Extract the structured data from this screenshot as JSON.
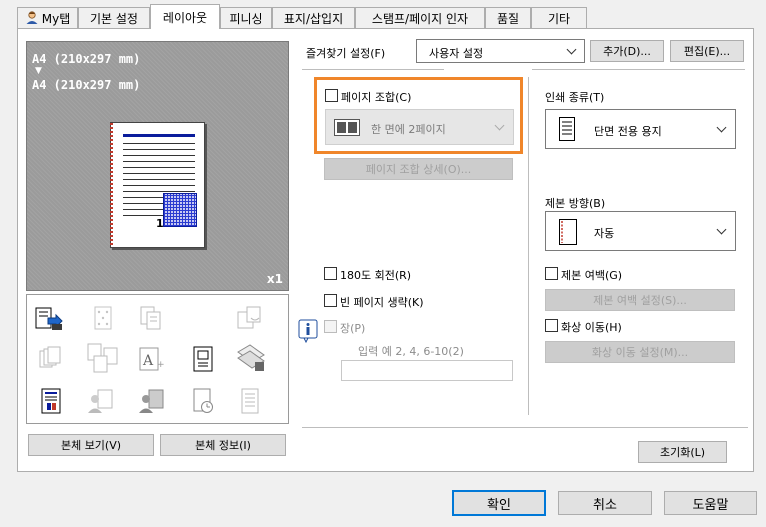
{
  "tabs": [
    {
      "label": "My탭",
      "active": false
    },
    {
      "label": "기본 설정",
      "active": false
    },
    {
      "label": "레이아웃",
      "active": true
    },
    {
      "label": "피니싱",
      "active": false
    },
    {
      "label": "표지/삽입지",
      "active": false
    },
    {
      "label": "스탬프/페이지 인자",
      "active": false
    },
    {
      "label": "품질",
      "active": false
    },
    {
      "label": "기타",
      "active": false
    }
  ],
  "preview": {
    "paper_line1": "A4 (210x297 mm)",
    "arrow": "▼",
    "paper_line2": "A4 (210x297 mm)",
    "copies": "x1",
    "page_number": "1"
  },
  "left_buttons": {
    "view_main": "본체 보기(V)",
    "info_main": "본체 정보(I)"
  },
  "favorites": {
    "label": "즐겨찾기 설정(F)",
    "value": "사용자 설정",
    "add_button": "추가(D)...",
    "edit_button": "편집(E)..."
  },
  "combine": {
    "checkbox_label": "페이지 조합(C)",
    "dropdown_value": "한 면에 2페이지",
    "detail_button": "페이지 조합 상세(O)..."
  },
  "print_type": {
    "label": "인쇄 종류(T)",
    "value": "단면 전용 용지"
  },
  "binding": {
    "label": "제본 방향(B)",
    "value": "자동"
  },
  "rotate": {
    "label": "180도 회전(R)"
  },
  "skip_blank": {
    "label": "빈 페이지 생략(K)"
  },
  "chapter": {
    "label": "장(P)",
    "hint": "입력 예 2, 4, 6-10(2)",
    "value": ""
  },
  "margin": {
    "label": "제본 여백(G)",
    "button": "제본 여백 설정(S)..."
  },
  "shift": {
    "label": "화상 이동(H)",
    "button": "화상 이동 설정(M)..."
  },
  "reset_button": "초기화(L)",
  "footer": {
    "ok": "확인",
    "cancel": "취소",
    "help": "도움말"
  },
  "colors": {
    "highlight_border": "#f0862a",
    "accent_blue": "#0078d7",
    "preview_bg": "#9b9b9b",
    "page_blue": "#0a1c9c"
  }
}
